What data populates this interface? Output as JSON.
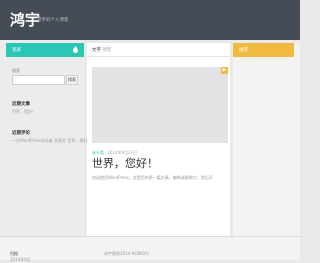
{
  "header": {
    "site_title": "鸿宇",
    "tagline": "鸿宇的个人博客"
  },
  "left_panel": {
    "header_label": "宽屏",
    "search": {
      "label": "搜索",
      "button_label": "搜索",
      "value": ""
    },
    "recent_posts": {
      "title": "近期文章",
      "items": [
        "世界，您好！"
      ]
    },
    "recent_comments": {
      "title": "近期评论",
      "items": [
        "一位WordPress评论者 发表在 世界，您好！"
      ]
    }
  },
  "main": {
    "header_title": "文字",
    "header_sub": "博客",
    "post": {
      "category": "未分类",
      "date": "2014年9月27日",
      "title": "世界，您好！",
      "excerpt": "欢迎使用WordPress。这是您的第一篇文章。编辑或删除它，然后开"
    }
  },
  "right_panel": {
    "header_label": "推荐"
  },
  "footer": {
    "left_title": "归档",
    "left_sub": "2014年9月",
    "center_text": "鸿宇版权2014 HONGYU"
  },
  "colors": {
    "header_bg": "#464c55",
    "teal_accent": "#2bc6b6",
    "yellow_accent": "#f0b93f"
  }
}
